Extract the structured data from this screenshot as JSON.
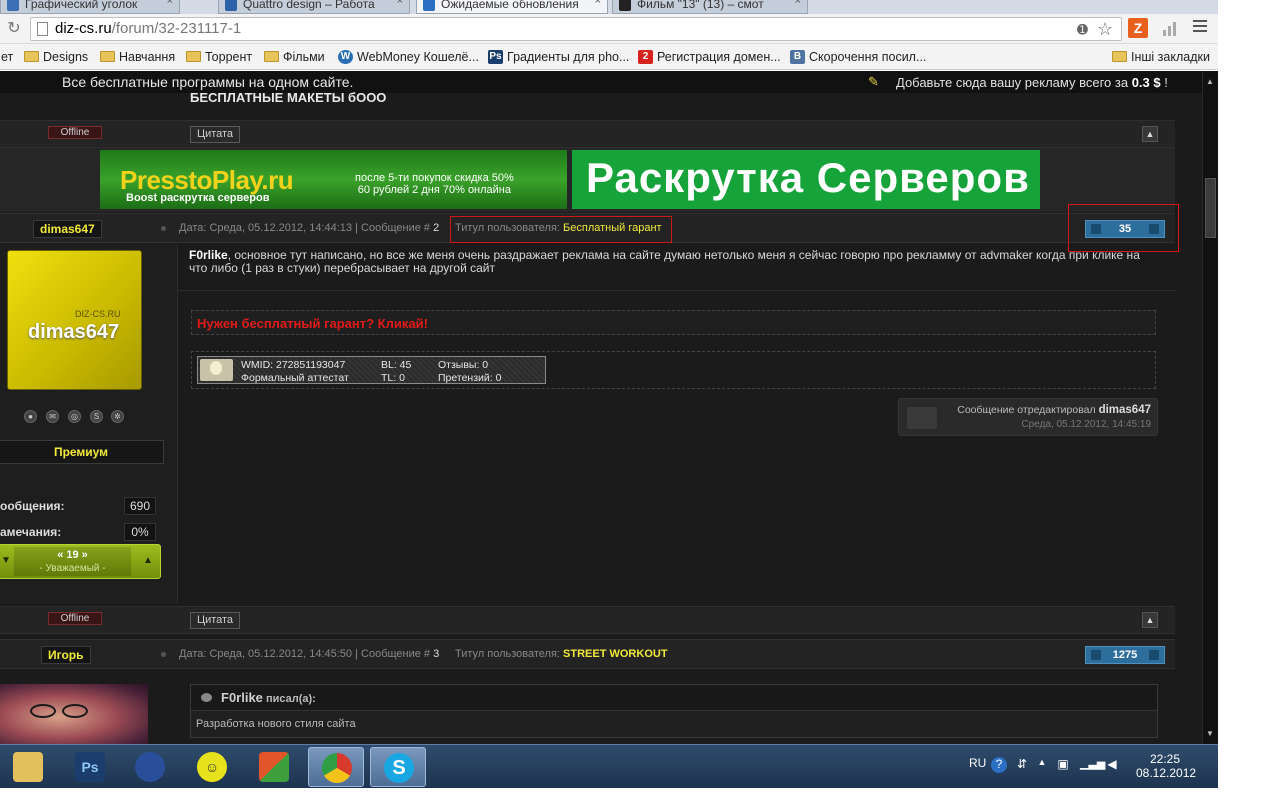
{
  "browser": {
    "tabs": [
      {
        "label": "Графический уголок",
        "active": false
      },
      {
        "label": "Quattro design – Работа",
        "active": false
      },
      {
        "label": "Ожидаемые обновления",
        "active": true
      },
      {
        "label": "Фильм \"13\" (13) – смот",
        "active": false
      }
    ],
    "url_host": "diz-cs.ru",
    "url_path": "/forum/32-231117-1",
    "ext_label": "Z",
    "bookmarks": [
      {
        "label": "ет",
        "icon": "folder-icon"
      },
      {
        "label": "Designs",
        "icon": "folder-icon"
      },
      {
        "label": "Навчання",
        "icon": "folder-icon"
      },
      {
        "label": "Торрент",
        "icon": "folder-icon"
      },
      {
        "label": "Фільми",
        "icon": "folder-icon"
      },
      {
        "label": "WebMoney Кошелё...",
        "icon": "webmoney-icon"
      },
      {
        "label": "Градиенты для pho...",
        "icon": "photoshop-icon"
      },
      {
        "label": "Регистрация домен...",
        "icon": "domain-icon"
      },
      {
        "label": "Скорочення посил...",
        "icon": "vk-icon"
      },
      {
        "label": "Інші закладки",
        "icon": "folder-icon"
      }
    ]
  },
  "site": {
    "topbar_left": "Все бесплатные программы на одном сайте.",
    "topbar_right_prefix": "Добавьте сюда вашу рекламу всего за ",
    "topbar_right_price": "0.3 $",
    "topbar_right_suffix": " !",
    "prev_title": "БЕСПЛАТНЫЕ МАКЕТЫ бООО"
  },
  "common": {
    "offline": "Offline",
    "quote": "Цитата",
    "up_arrow": "▲"
  },
  "ads": {
    "ad1_brand": "PresstoPlay.ru",
    "ad1_sub": "Boost раскрутка серверов",
    "ad1_promo_1": "после 5-ти покупок скидка 50%",
    "ad1_promo_2": "60 рублей 2 дня 70% онлайна",
    "ad2_text": "Раскрутка Серверов"
  },
  "post2": {
    "author": "dimas647",
    "meta_date": "Дата: Среда, 05.12.2012, 14:44:13 | Сообщение # ",
    "meta_num": "2",
    "title_label": "Титул пользователя: ",
    "title_value": "Бесплатный гарант",
    "rating": "35",
    "avatar_small": "DIZ-CS.RU",
    "avatar_big": "dimas647",
    "rank": "Премиум",
    "messages_label": "ообщения:",
    "messages_value": "690",
    "remarks_label": "амечания:",
    "remarks_value": "0%",
    "rep_value": "« 19 »",
    "rep_title": "- Уважаемый -",
    "text_author": "F0rlike",
    "text_body": ", основное тут написано, но все же меня очень раздражает реклама на сайте думаю нетолько меня я сейчас говорю про рекламму от advmaker когда при клике на что либо (1 раз в стуки) перебрасывает на другой сайт",
    "guarantee": "Нужен бесплатный гарант? Кликай!",
    "wm_id": "WMID: 272851193047",
    "wm_bl": "BL: 45",
    "wm_reviews": "Отзывы: 0",
    "wm_attestat": "Формальный аттестат",
    "wm_tl": "TL: 0",
    "wm_claims": "Претензий: 0",
    "edited_prefix": "Сообщение отредактировал ",
    "edited_by": "dimas647",
    "edited_date": "Среда, 05.12.2012, 14:45:19"
  },
  "post3": {
    "author": "Игорь",
    "meta_date": "Дата: Среда, 05.12.2012, 14:45:50 | Сообщение # ",
    "meta_num": "3",
    "title_label": "Титул пользователя: ",
    "title_value": "STREET WORKOUT",
    "rating": "1275",
    "quote_author": "F0rlike",
    "quote_wrote": " писал(а):",
    "quote_text": "Разработка нового стиля сайта"
  },
  "taskbar": {
    "apps": [
      "explorer-icon",
      "photoshop-icon",
      "firefox-icon",
      "smiley-icon",
      "windows-update-icon",
      "chrome-icon",
      "skype-icon"
    ],
    "lang": "RU",
    "time": "22:25",
    "date": "08.12.2012"
  }
}
